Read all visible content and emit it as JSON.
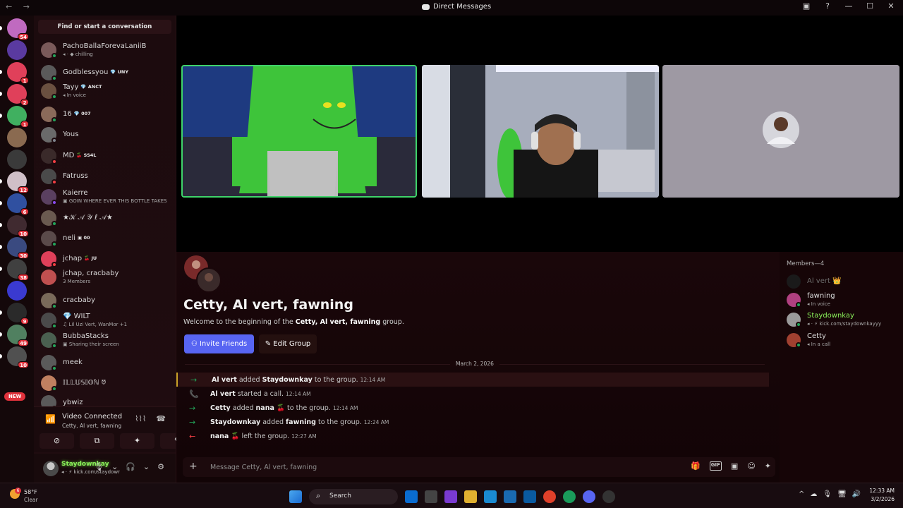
{
  "window": {
    "nav_label": "← →",
    "title": "Direct Messages",
    "titlebar_icons": [
      "▣",
      "?",
      "—",
      "☐",
      "✕"
    ]
  },
  "servers": [
    {
      "color": "#c06ac0",
      "badge": "54",
      "pip": true
    },
    {
      "color": "#5a3aa0",
      "badge": "",
      "pip": false
    },
    {
      "color": "#e0405a",
      "badge": "1",
      "pip": true
    },
    {
      "color": "#e0405a",
      "badge": "2",
      "pip": true
    },
    {
      "color": "#40b060",
      "badge": "1",
      "pip": true
    },
    {
      "color": "#8a6a50",
      "badge": "",
      "pip": false
    },
    {
      "color": "#3a3a3a",
      "badge": "",
      "pip": false
    },
    {
      "color": "#d0c0c8",
      "badge": "12",
      "pip": true
    },
    {
      "color": "#3050a0",
      "badge": "6",
      "pip": true
    },
    {
      "color": "#402a30",
      "badge": "10",
      "pip": true
    },
    {
      "color": "#3a4a80",
      "badge": "30",
      "pip": true
    },
    {
      "color": "#404040",
      "badge": "38",
      "pip": true
    },
    {
      "color": "#3a3ad0",
      "badge": "",
      "pip": false
    },
    {
      "color": "#2a2a2a",
      "badge": "9",
      "pip": true
    },
    {
      "color": "#508060",
      "badge": "49",
      "pip": true
    },
    {
      "color": "#505050",
      "badge": "10",
      "pip": true
    }
  ],
  "server_new_label": "NEW",
  "sidebar": {
    "find_label": "Find or start a conversation",
    "dms": [
      {
        "name": "PachoBallaForevaLaniiB",
        "tag": "",
        "sub": "◂ · ◆ chilling",
        "color": "#7a5a5a",
        "status": "#23a55a"
      },
      {
        "name": "Godblessyou",
        "tag": "💎 UNY",
        "sub": "",
        "color": "#5a5a5a",
        "status": "#23a55a"
      },
      {
        "name": "Tayy",
        "tag": "💎 ANCT",
        "sub": "◂ In voice",
        "color": "#6a5040",
        "status": "#23a55a"
      },
      {
        "name": "16",
        "tag": "💎 007",
        "sub": "",
        "color": "#8a6a5a",
        "status": "#23a55a"
      },
      {
        "name": "Yous",
        "tag": "",
        "sub": "",
        "color": "#6a6a6a",
        "status": "#80848e"
      },
      {
        "name": "MD",
        "tag": "🍒 SS4L",
        "sub": "",
        "color": "#3a2a2a",
        "status": "#f23f43"
      },
      {
        "name": "Fatruss",
        "tag": "",
        "sub": "",
        "color": "#4a4a4a",
        "status": "#f23f43"
      },
      {
        "name": "Kaierre",
        "tag": "",
        "sub": "▣ GOIN WHERE EVER THIS BOTTLE TAKES",
        "color": "#5a4060",
        "status": "#8a4af0"
      },
      {
        "name": "★𝒦 𝒜 𝒴 ℓ 𝒜★",
        "tag": "",
        "sub": "",
        "color": "#6a5a50",
        "status": "#23a55a"
      },
      {
        "name": "neli",
        "tag": "▣ 00",
        "sub": "",
        "color": "#5a4a4a",
        "status": "#23a55a"
      },
      {
        "name": "jchap",
        "tag": "🍒 JU",
        "sub": "",
        "color": "#e0405a",
        "status": "#f23f43"
      },
      {
        "name": "jchap, cracbaby",
        "tag": "",
        "sub": "3 Members",
        "color": "#c05050",
        "status": ""
      },
      {
        "name": "cracbaby",
        "tag": "",
        "sub": "",
        "color": "#7a6a5a",
        "status": "#23a55a"
      },
      {
        "name": "💎 WILT",
        "tag": "",
        "sub": "♫ Lil Uzi Vert, WanMor +1",
        "color": "#4a4a4a",
        "status": "#23a55a"
      },
      {
        "name": "BubbaStacks",
        "tag": "",
        "sub": "▣ Sharing their screen",
        "color": "#4a6050",
        "status": "#23a55a"
      },
      {
        "name": "meek",
        "tag": "",
        "sub": "",
        "color": "#5a5a5a",
        "status": "#23a55a"
      },
      {
        "name": "𝕀𝕃𝕃𝕌𝕊𝕀𝕆ℕ",
        "tag": "😈",
        "sub": "",
        "color": "#c08060",
        "status": "#23a55a"
      },
      {
        "name": "ybwiz",
        "tag": "",
        "sub": "",
        "color": "#5a5a5a",
        "status": "#23a55a"
      }
    ]
  },
  "voice": {
    "status": "Video Connected",
    "channel": "Cetty, Al vert, fawning",
    "signal_icon": "📶",
    "action_icons": [
      "⌇⌇⌇",
      "☎"
    ],
    "buttons": [
      "⊘",
      "⧉",
      "✦",
      "✎"
    ]
  },
  "user": {
    "name": "Staydownkay",
    "status": "◂ · ⚡ kick.com/staydowr",
    "controls": [
      "🎙",
      "⌄",
      "🎧",
      "⌄",
      "⚙"
    ]
  },
  "group": {
    "title": "Cetty, Al vert, fawning",
    "welcome_prefix": "Welcome to the beginning of the",
    "welcome_name": "Cetty, Al vert, fawning",
    "welcome_suffix": "group.",
    "invite_label": "Invite Friends",
    "edit_label": "Edit Group"
  },
  "date_divider": "March 2, 2026",
  "messages": [
    {
      "icon": "→",
      "color": "#23a55a",
      "actor": "Al vert",
      "action": "added",
      "target": "Staydownkay",
      "rest": "to the group.",
      "time": "12:14 AM",
      "highlight": true
    },
    {
      "icon": "📞",
      "color": "#23a55a",
      "actor": "Al vert",
      "action": "started a call.",
      "target": "",
      "rest": "",
      "time": "12:14 AM",
      "highlight": false
    },
    {
      "icon": "→",
      "color": "#23a55a",
      "actor": "Cetty",
      "action": "added",
      "target": "nana 🍒",
      "rest": "to the group.",
      "time": "12:14 AM",
      "highlight": false
    },
    {
      "icon": "→",
      "color": "#23a55a",
      "actor": "Staydownkay",
      "action": "added",
      "target": "fawning",
      "rest": "to the group.",
      "time": "12:24 AM",
      "highlight": false
    },
    {
      "icon": "←",
      "color": "#f23f43",
      "actor": "nana 🍒",
      "action": "left the group.",
      "target": "",
      "rest": "",
      "time": "12:27 AM",
      "highlight": false
    }
  ],
  "composer": {
    "plus": "+",
    "placeholder": "Message Cetty, Al vert, fawning",
    "tools": [
      "🎁",
      "GIF",
      "▣",
      "☺",
      "✦"
    ]
  },
  "members": {
    "header": "Members—4",
    "list": [
      {
        "name": "Al vert 👑",
        "sub": "",
        "color": "#1a1a1a",
        "status": "",
        "name_color": "#6a6a6a"
      },
      {
        "name": "fawning",
        "sub": "◂ In voice",
        "color": "#b04080",
        "status": "#23a55a",
        "name_color": "#dedede"
      },
      {
        "name": "Staydownkay",
        "sub": "◂ · ⚡ kick.com/staydownkayyy",
        "color": "#9a9a9a",
        "status": "#23a55a",
        "name_color": "#8af05a"
      },
      {
        "name": "Cetty",
        "sub": "◂ In a call",
        "color": "#a04030",
        "status": "#23a55a",
        "name_color": "#dedede"
      }
    ]
  },
  "taskbar": {
    "weather_temp": "58°F",
    "weather_cond": "Clear",
    "weather_badge": "6",
    "search_label": "Search",
    "search_icon": "⌕",
    "apps": [
      "#0a6cd0",
      "#444",
      "#7a3ad0",
      "#e0b030",
      "#1a8ad0",
      "#1a6ab0",
      "#0a5aa0",
      "#e0402a",
      "#1a9a5a",
      "#5865f2",
      "#333"
    ],
    "tray": [
      "^",
      "☁",
      "🎙",
      "🖥",
      "🔊"
    ],
    "time": "12:33 AM",
    "date": "3/2/2026"
  }
}
